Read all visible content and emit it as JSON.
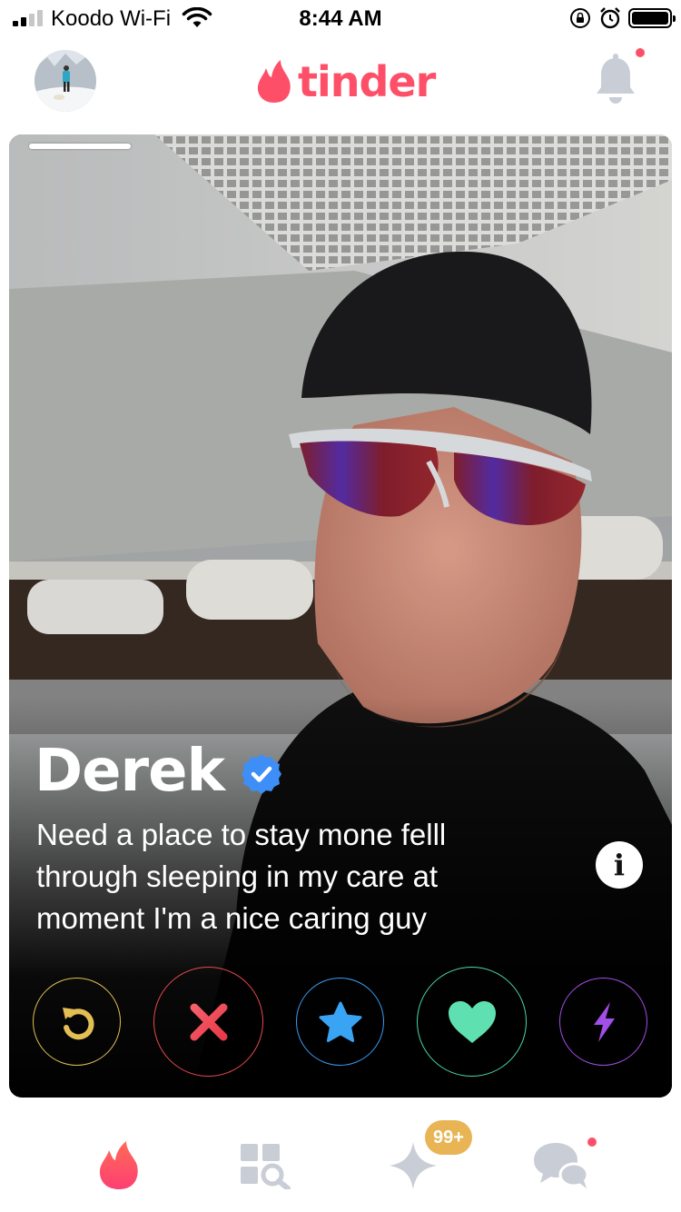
{
  "status_bar": {
    "carrier": "Koodo Wi-Fi",
    "time": "8:44 AM",
    "signal_bars_filled": 2,
    "signal_bars_total": 4,
    "battery_level": 1.0,
    "icons": [
      "signal-icon",
      "wifi-icon",
      "rotation-lock-icon",
      "alarm-icon",
      "battery-icon"
    ]
  },
  "header": {
    "logo_text": "tinder",
    "brand_color": "#fd5068",
    "icons": [
      "profile-avatar",
      "tinder-flame-icon",
      "bell-icon"
    ],
    "notification_dot": true
  },
  "profile": {
    "name": "Derek",
    "verified": true,
    "bio": "Need a place to stay mone felll\nthrough sleeping in my care at\nmoment  I'm a nice caring guy",
    "photo_count_shown": 1,
    "info_label": "i"
  },
  "actions": [
    {
      "id": "rewind",
      "icon": "rewind-icon",
      "color": "#e2be54"
    },
    {
      "id": "nope",
      "icon": "close-icon",
      "color": "#e8494f"
    },
    {
      "id": "superlike",
      "icon": "star-icon",
      "color": "#3a9bf0"
    },
    {
      "id": "like",
      "icon": "heart-icon",
      "color": "#4bd8a3"
    },
    {
      "id": "boost",
      "icon": "lightning-icon",
      "color": "#a24ee8"
    }
  ],
  "tab_bar": {
    "tabs": [
      {
        "id": "home",
        "icon": "flame-icon",
        "active": true
      },
      {
        "id": "explore",
        "icon": "explore-grid-icon",
        "active": false
      },
      {
        "id": "gold",
        "icon": "sparkle-icon",
        "active": false
      },
      {
        "id": "messages",
        "icon": "chat-bubbles-icon",
        "active": false
      }
    ],
    "gold_badge": "99+",
    "messages_dot": true
  }
}
